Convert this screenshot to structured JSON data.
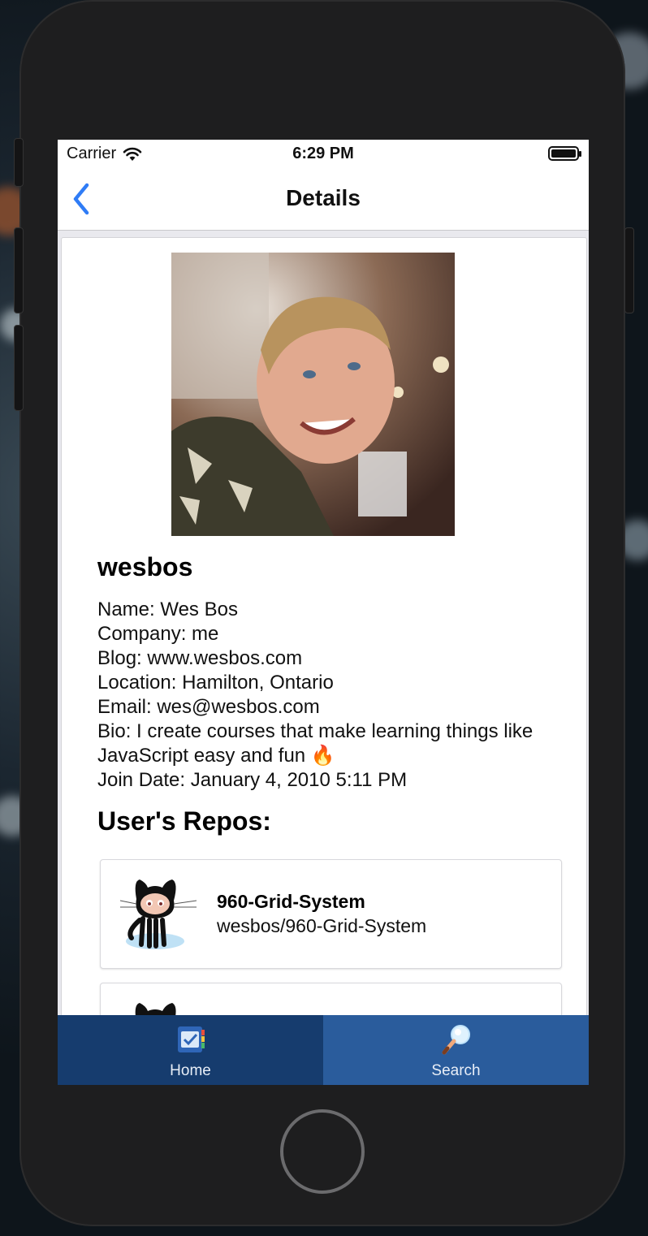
{
  "status_bar": {
    "carrier": "Carrier",
    "time": "6:29 PM"
  },
  "nav": {
    "title": "Details",
    "back_icon": "chevron-left-icon"
  },
  "profile": {
    "username": "wesbos",
    "name": "Name: Wes Bos",
    "company": "Company: me",
    "blog": "Blog: www.wesbos.com",
    "location": "Location: Hamilton, Ontario",
    "email": "Email: wes@wesbos.com",
    "bio": "Bio: I create courses that make learning things like JavaScript easy and fun 🔥",
    "join_date": "Join Date: January 4, 2010 5:11 PM"
  },
  "repos": {
    "title": "User's Repos:",
    "items": [
      {
        "name": "960-Grid-System",
        "full_name": "wesbos/960-Grid-System"
      },
      {
        "name": "",
        "full_name": ""
      }
    ]
  },
  "tabs": [
    {
      "label": "Home",
      "icon": "notebook-check-icon"
    },
    {
      "label": "Search",
      "icon": "magnifier-icon"
    }
  ],
  "colors": {
    "tab_home": "#163c6e",
    "tab_search": "#2a5c9c",
    "back_blue": "#2f7cf6"
  }
}
